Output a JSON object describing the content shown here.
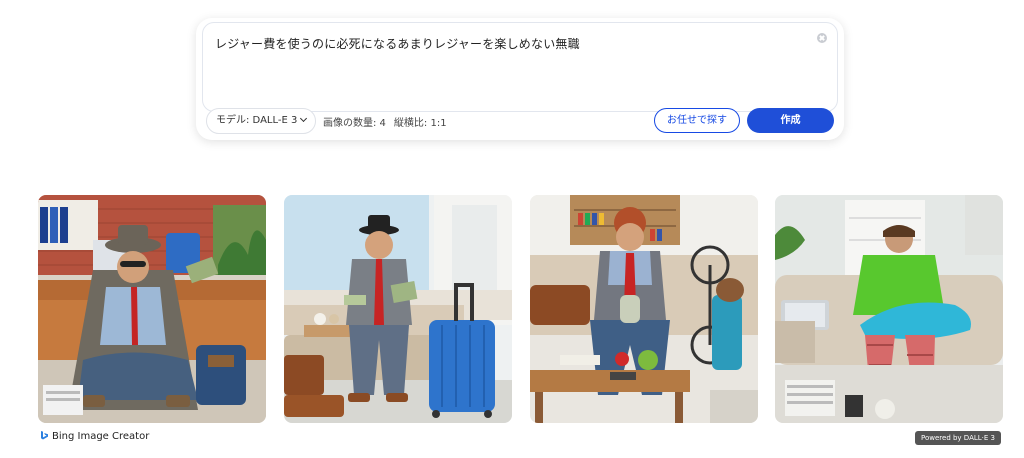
{
  "prompt": {
    "text": "レジャー費を使うのに必死になるあまりレジャーを楽しめない無職"
  },
  "controls": {
    "model_label": "モデル: DALL-E 3",
    "image_count": "画像の数量: 4",
    "aspect_ratio": "縦横比: 1:1",
    "surprise_label": "お任せで探す",
    "create_label": "作成"
  },
  "images": [
    {
      "scene": "man-with-money-office"
    },
    {
      "scene": "man-with-money-suitcase"
    },
    {
      "scene": "man-with-alarm-clock"
    },
    {
      "scene": "man-with-pillow-laptop"
    }
  ],
  "footer": {
    "brand": "Bing Image Creator",
    "powered_by": "Powered by DALL·E 3"
  },
  "colors": {
    "accent": "#1f4fd8",
    "outline_accent": "#174ae4"
  }
}
